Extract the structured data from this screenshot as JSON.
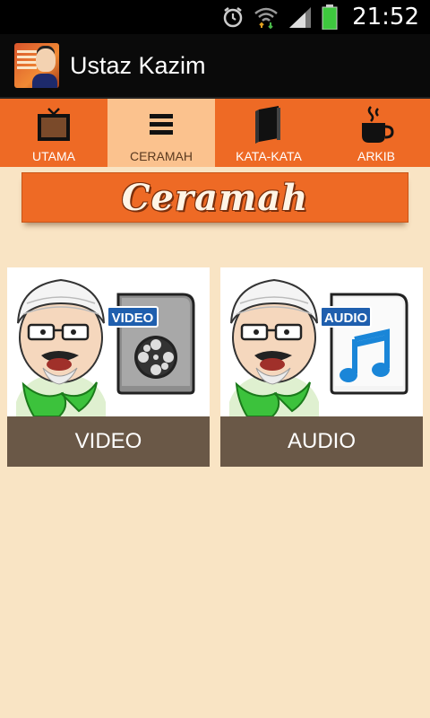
{
  "status_bar": {
    "time": "21:52",
    "icons": [
      "alarm-icon",
      "wifi-icon",
      "signal-icon",
      "battery-icon"
    ]
  },
  "action_bar": {
    "title": "Ustaz Kazim",
    "logo_icon": "app-logo"
  },
  "tabs": [
    {
      "label": "UTAMA",
      "icon": "tv-icon",
      "active": false
    },
    {
      "label": "CERAMAH",
      "icon": "menu-lines-icon",
      "active": true
    },
    {
      "label": "KATA-KATA",
      "icon": "book-icon",
      "active": false
    },
    {
      "label": "ARKIB",
      "icon": "coffee-cup-icon",
      "active": false
    }
  ],
  "banner": {
    "title": "Ceramah"
  },
  "cards": [
    {
      "label": "VIDEO",
      "badge": "VIDEO",
      "icon": "film-reel-icon"
    },
    {
      "label": "AUDIO",
      "badge": "AUDIO",
      "icon": "music-note-icon"
    }
  ],
  "colors": {
    "background": "#f9e4c4",
    "accent_orange": "#ee6a25",
    "active_tab": "#fbc28e",
    "card_caption": "#6a5847",
    "status_bar": "#000000",
    "battery_green": "#3ec83e"
  }
}
